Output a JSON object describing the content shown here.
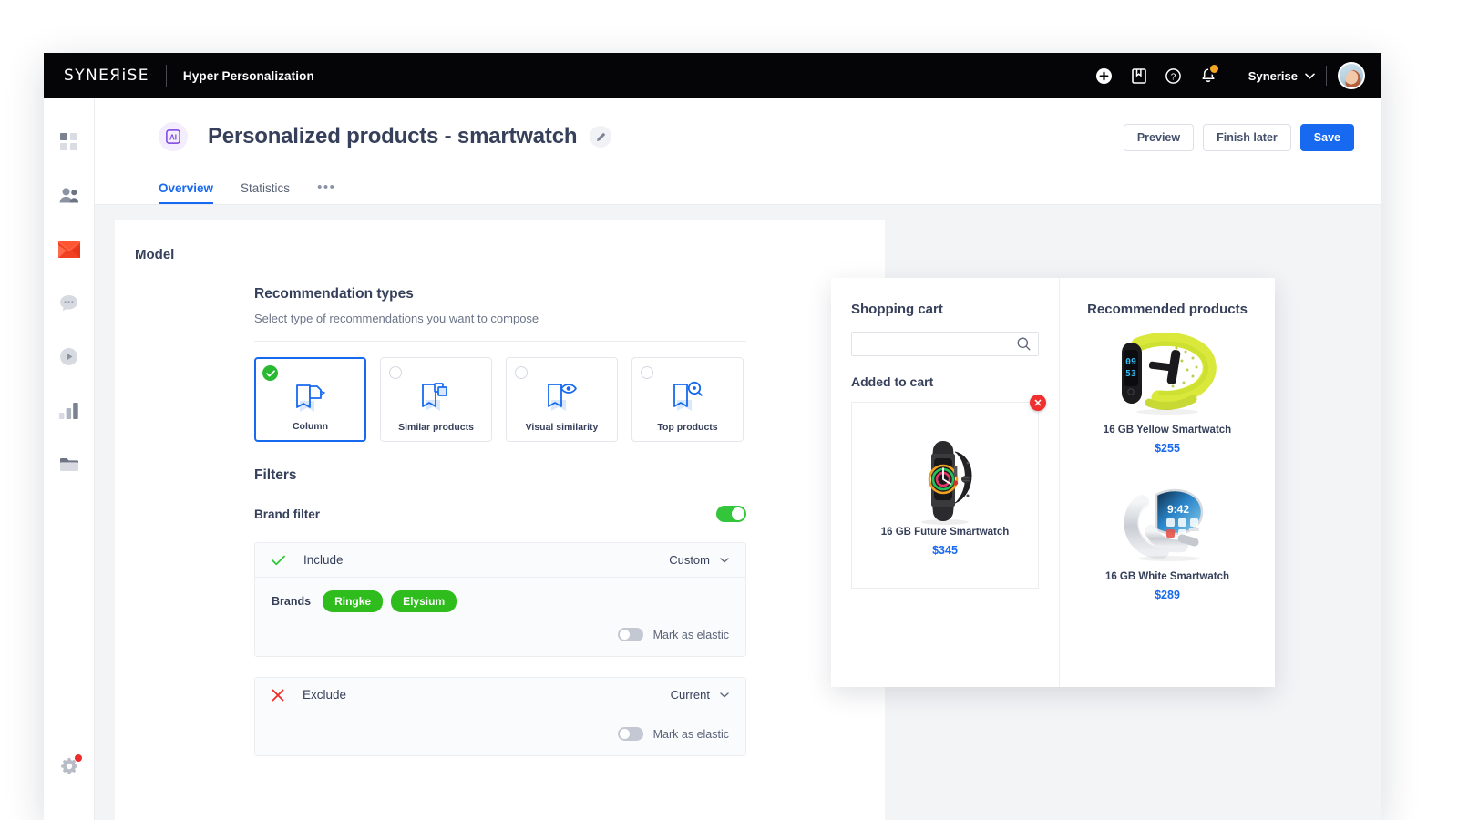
{
  "topbar": {
    "logo": "SYNEЯiSE",
    "product": "Hyper Personalization",
    "icons": [
      "plus-circle-icon",
      "book-icon",
      "help-circle-icon",
      "bell-icon"
    ],
    "org": "Synerise"
  },
  "sidebar": {
    "items": [
      {
        "name": "dashboard-icon",
        "active": false
      },
      {
        "name": "audiences-icon",
        "active": false
      },
      {
        "name": "communication-icon",
        "active": true
      },
      {
        "name": "chat-icon",
        "active": false
      },
      {
        "name": "automation-icon",
        "active": false
      },
      {
        "name": "analytics-icon",
        "active": false
      },
      {
        "name": "catalog-icon",
        "active": false
      }
    ],
    "settings_icon": "gear-icon"
  },
  "page": {
    "badge": "AI",
    "title": "Personalized products - smartwatch",
    "edit_label": "✎",
    "actions": {
      "preview": "Preview",
      "finish_later": "Finish later",
      "save": "Save"
    },
    "tabs": [
      {
        "label": "Overview",
        "active": true
      },
      {
        "label": "Statistics",
        "active": false
      }
    ],
    "tabs_more": "•••"
  },
  "model": {
    "card_title": "Model",
    "recommendation_types": {
      "heading": "Recommendation types",
      "subheading": "Select type of recommendations you want to compose",
      "options": [
        {
          "label": "Column",
          "icon": "bookmark-column-icon",
          "selected": true
        },
        {
          "label": "Similar products",
          "icon": "bookmark-similar-icon",
          "selected": false
        },
        {
          "label": "Visual similarity",
          "icon": "bookmark-eye-icon",
          "selected": false
        },
        {
          "label": "Top products",
          "icon": "bookmark-top-icon",
          "selected": false
        }
      ]
    },
    "filters": {
      "heading": "Filters",
      "brand_filter_label": "Brand filter",
      "brand_filter_enabled": true,
      "include": {
        "label": "Include",
        "icon": "check-icon",
        "mode": "Custom",
        "brands_label": "Brands",
        "brands": [
          "Ringke",
          "Elysium"
        ],
        "elastic_label": "Mark as elastic",
        "elastic_enabled": false
      },
      "exclude": {
        "label": "Exclude",
        "icon": "x-icon",
        "mode": "Current",
        "elastic_label": "Mark as elastic",
        "elastic_enabled": false
      }
    }
  },
  "preview_widget": {
    "cart": {
      "heading": "Shopping cart",
      "search_value": "",
      "search_placeholder": "",
      "search_icon": "search-icon",
      "added_label": "Added to cart",
      "remove_label": "✕",
      "item": {
        "name": "16 GB Future Smartwatch",
        "price": "$345",
        "image": "dark-smartwatch"
      }
    },
    "recommended": {
      "heading": "Recommended products",
      "items": [
        {
          "name": "16 GB Yellow Smartwatch",
          "price": "$255",
          "image": "yellow-fitness-band"
        },
        {
          "name": "16 GB White Smartwatch",
          "price": "$289",
          "image": "white-curved-smartwatch"
        }
      ]
    }
  },
  "colors": {
    "accent_blue": "#1769f0",
    "green": "#34c63a",
    "chip_green": "#2fbd1d",
    "red": "#f02f2f",
    "orange": "#f5a623",
    "topbar_bg": "#050507",
    "text_dark": "#36405a"
  }
}
